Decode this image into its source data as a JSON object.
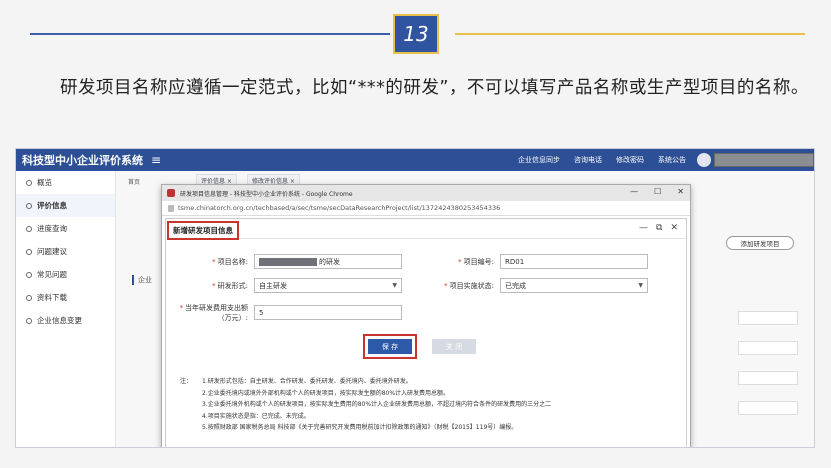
{
  "slide": {
    "number": "13",
    "text": "研发项目名称应遵循一定范式，比如“***的研发”，不可以填写产品名称或生产型项目的名称。",
    "colors": {
      "primary": "#2f54a0",
      "accent": "#e9c14a",
      "highlight": "#c8352c"
    }
  },
  "app": {
    "title": "科技型中小企业评价系统",
    "menu_icon": "≡",
    "topnav": [
      "企业信息同步",
      "咨询电话",
      "修改密码",
      "系统公告"
    ],
    "sidebar": [
      "概览",
      "评价信息",
      "进度查询",
      "问题建议",
      "常见问题",
      "资料下载",
      "企业信息变更"
    ],
    "breadcrumb": "首页",
    "tabs": [
      "评价信息 ×",
      "修改评价信息 ×"
    ],
    "add_button": "添加研发项目",
    "section_label": "企业"
  },
  "chrome": {
    "title": "研发项目信息管理 - 科技型中小企业评价系统 - Google Chrome",
    "url": "tsme.chinatorch.org.cn/techbased/a/sec/tsme/secDataResearchProject/list/1372424380253454336",
    "controls": [
      "—",
      "☐",
      "✕"
    ]
  },
  "dialog": {
    "title": "新增研发项目信息",
    "controls": [
      "—",
      "⧉",
      "✕"
    ],
    "fields": {
      "name_label": "项目名称:",
      "name_value": "的研发",
      "code_label": "项目编号:",
      "code_value": "RD01",
      "form_label": "研发形式:",
      "form_value": "自主研发",
      "status_label": "项目实施状态:",
      "status_value": "已完成",
      "expense_label": "当年研发费用支出额（万元）:",
      "expense_value": "5"
    },
    "save_label": "保 存",
    "close_label": "关 闭",
    "notes": [
      {
        "head": "注：",
        "text": "1.研发形式包括：自主研发、合作研发、委托研发、委托境内、委托境外研发。"
      },
      {
        "head": "",
        "text": "2.企业委托境内或境外外部机构或个人的研发项目，按实际发生额的80%计入研发费用总额。"
      },
      {
        "head": "",
        "text": "3.企业委托境外机构或个人的研发项目，按实际发生费用的80%计入企业研发费用总额，不超过境内符合条件的研发费用的三分之二"
      },
      {
        "head": "",
        "text": "4.项目实施状态是指：已完成、未完成。"
      },
      {
        "head": "",
        "text": "5.按照财政部 国家税务总局 科技部《关于完善研究开发费用税前加计扣除政策的通知》（财税【2015】119号）编报。"
      }
    ]
  }
}
